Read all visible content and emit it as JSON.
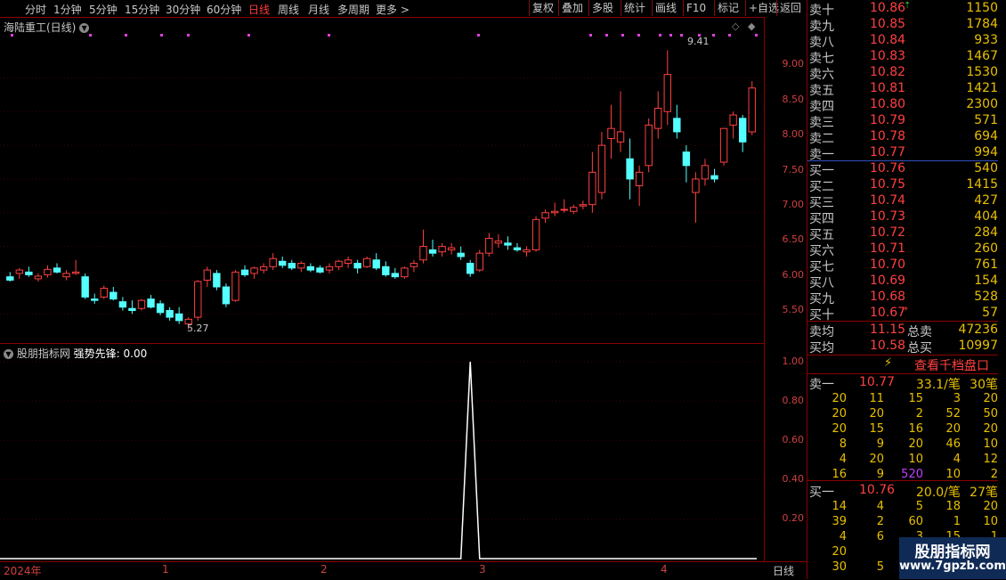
{
  "toolbar": {
    "periods": [
      "分时",
      "1分钟",
      "5分钟",
      "15分钟",
      "30分钟",
      "60分钟",
      "日线",
      "周线",
      "月线",
      "多周期",
      "更多 >"
    ],
    "active_period": "日线",
    "right_buttons": [
      "复权",
      "叠加",
      "多股",
      "统计",
      "画线",
      "F10",
      "标记",
      "+自选",
      "返回"
    ]
  },
  "main_chart": {
    "title": "海陆重工(日线)",
    "high_marker": "9.41",
    "low_marker": "5.27",
    "y_ticks": [
      "9.00",
      "8.50",
      "8.00",
      "7.50",
      "7.00",
      "6.50",
      "6.00",
      "5.50"
    ]
  },
  "indicator": {
    "title": "股朋指标网",
    "name_label": "强势先锋: 0.00",
    "y_ticks": [
      "1.00",
      "0.80",
      "0.60",
      "0.40",
      "0.20"
    ]
  },
  "date_axis": {
    "labels": [
      "2024年",
      "1",
      "2",
      "3",
      "4"
    ],
    "period_label": "日线"
  },
  "chart_data": {
    "type": "candlestick",
    "title": "海陆重工(日线)",
    "ylim": [
      5.2,
      9.6
    ],
    "candles": [
      [
        6.05,
        6.12,
        5.98,
        6.0
      ],
      [
        6.1,
        6.18,
        6.02,
        6.15
      ],
      [
        6.12,
        6.2,
        6.05,
        6.08
      ],
      [
        6.02,
        6.1,
        5.98,
        6.06
      ],
      [
        6.08,
        6.22,
        6.04,
        6.16
      ],
      [
        6.18,
        6.25,
        6.1,
        6.12
      ],
      [
        6.05,
        6.15,
        6.0,
        6.1
      ],
      [
        6.1,
        6.3,
        6.08,
        6.12
      ],
      [
        6.05,
        6.1,
        5.72,
        5.75
      ],
      [
        5.72,
        5.8,
        5.65,
        5.7
      ],
      [
        5.75,
        5.92,
        5.72,
        5.88
      ],
      [
        5.82,
        5.9,
        5.7,
        5.72
      ],
      [
        5.68,
        5.75,
        5.55,
        5.6
      ],
      [
        5.58,
        5.7,
        5.5,
        5.55
      ],
      [
        5.58,
        5.72,
        5.55,
        5.7
      ],
      [
        5.72,
        5.78,
        5.58,
        5.6
      ],
      [
        5.65,
        5.7,
        5.48,
        5.52
      ],
      [
        5.55,
        5.6,
        5.4,
        5.45
      ],
      [
        5.5,
        5.6,
        5.35,
        5.4
      ],
      [
        5.35,
        5.45,
        5.27,
        5.42
      ],
      [
        5.45,
        6.0,
        5.4,
        5.98
      ],
      [
        6.0,
        6.2,
        5.9,
        6.15
      ],
      [
        6.1,
        6.15,
        5.85,
        5.9
      ],
      [
        5.9,
        5.95,
        5.6,
        5.65
      ],
      [
        5.7,
        6.15,
        5.68,
        6.12
      ],
      [
        6.15,
        6.22,
        6.05,
        6.08
      ],
      [
        6.1,
        6.2,
        6.02,
        6.18
      ],
      [
        6.15,
        6.25,
        6.1,
        6.2
      ],
      [
        6.2,
        6.4,
        6.15,
        6.32
      ],
      [
        6.28,
        6.35,
        6.18,
        6.22
      ],
      [
        6.25,
        6.3,
        6.15,
        6.18
      ],
      [
        6.18,
        6.28,
        6.12,
        6.25
      ],
      [
        6.2,
        6.25,
        6.12,
        6.15
      ],
      [
        6.18,
        6.22,
        6.1,
        6.12
      ],
      [
        6.15,
        6.25,
        6.1,
        6.2
      ],
      [
        6.2,
        6.3,
        6.15,
        6.28
      ],
      [
        6.25,
        6.35,
        6.18,
        6.3
      ],
      [
        6.25,
        6.3,
        6.1,
        6.18
      ],
      [
        6.2,
        6.35,
        6.18,
        6.32
      ],
      [
        6.3,
        6.4,
        6.15,
        6.18
      ],
      [
        6.2,
        6.28,
        6.05,
        6.08
      ],
      [
        6.1,
        6.18,
        6.02,
        6.05
      ],
      [
        6.05,
        6.2,
        6.02,
        6.18
      ],
      [
        6.2,
        6.3,
        6.12,
        6.25
      ],
      [
        6.3,
        6.75,
        6.25,
        6.5
      ],
      [
        6.45,
        6.6,
        6.35,
        6.4
      ],
      [
        6.42,
        6.55,
        6.35,
        6.5
      ],
      [
        6.45,
        6.55,
        6.38,
        6.48
      ],
      [
        6.4,
        6.5,
        6.3,
        6.35
      ],
      [
        6.25,
        6.3,
        6.05,
        6.1
      ],
      [
        6.15,
        6.45,
        6.12,
        6.4
      ],
      [
        6.4,
        6.7,
        6.35,
        6.62
      ],
      [
        6.55,
        6.68,
        6.48,
        6.58
      ],
      [
        6.55,
        6.65,
        6.45,
        6.52
      ],
      [
        6.48,
        6.55,
        6.42,
        6.45
      ],
      [
        6.42,
        6.5,
        6.35,
        6.45
      ],
      [
        6.45,
        6.95,
        6.42,
        6.9
      ],
      [
        6.92,
        7.05,
        6.85,
        7.0
      ],
      [
        7.0,
        7.15,
        6.95,
        7.02
      ],
      [
        7.05,
        7.2,
        7.0,
        7.05
      ],
      [
        7.02,
        7.12,
        6.98,
        7.08
      ],
      [
        7.1,
        7.18,
        7.05,
        7.12
      ],
      [
        7.12,
        7.9,
        7.0,
        7.6
      ],
      [
        7.3,
        8.2,
        7.2,
        8.0
      ],
      [
        8.1,
        8.6,
        7.8,
        8.25
      ],
      [
        8.05,
        8.8,
        7.9,
        8.2
      ],
      [
        7.8,
        8.1,
        7.2,
        7.5
      ],
      [
        7.4,
        7.7,
        7.1,
        7.6
      ],
      [
        7.7,
        8.4,
        7.6,
        8.3
      ],
      [
        8.25,
        8.8,
        8.1,
        8.55
      ],
      [
        8.5,
        9.41,
        8.3,
        9.05
      ],
      [
        8.4,
        8.6,
        8.1,
        8.2
      ],
      [
        7.9,
        8.0,
        7.45,
        7.7
      ],
      [
        7.3,
        7.6,
        6.85,
        7.5
      ],
      [
        7.5,
        7.8,
        7.4,
        7.7
      ],
      [
        7.55,
        7.65,
        7.45,
        7.5
      ],
      [
        7.75,
        8.2,
        7.7,
        8.25
      ],
      [
        8.3,
        8.5,
        8.1,
        8.45
      ],
      [
        8.4,
        8.45,
        7.9,
        8.05
      ],
      [
        8.2,
        8.95,
        8.15,
        8.85
      ]
    ],
    "indicator_series": {
      "name": "强势先锋",
      "ylim": [
        0,
        1.0
      ],
      "spike_index": 49,
      "values_note": "0 everywhere except 1.00 at spike_index"
    }
  },
  "order_book": {
    "asks": [
      {
        "label": "卖十",
        "price": "10.86",
        "vol": "1150"
      },
      {
        "label": "卖九",
        "price": "10.85",
        "vol": "1784"
      },
      {
        "label": "卖八",
        "price": "10.84",
        "vol": "933"
      },
      {
        "label": "卖七",
        "price": "10.83",
        "vol": "1467"
      },
      {
        "label": "卖六",
        "price": "10.82",
        "vol": "1530"
      },
      {
        "label": "卖五",
        "price": "10.81",
        "vol": "1421"
      },
      {
        "label": "卖四",
        "price": "10.80",
        "vol": "2300"
      },
      {
        "label": "卖三",
        "price": "10.79",
        "vol": "571"
      },
      {
        "label": "卖二",
        "price": "10.78",
        "vol": "694"
      },
      {
        "label": "卖一",
        "price": "10.77",
        "vol": "994"
      }
    ],
    "bids": [
      {
        "label": "买一",
        "price": "10.76",
        "vol": "540"
      },
      {
        "label": "买二",
        "price": "10.75",
        "vol": "1415"
      },
      {
        "label": "买三",
        "price": "10.74",
        "vol": "427"
      },
      {
        "label": "买四",
        "price": "10.73",
        "vol": "404"
      },
      {
        "label": "买五",
        "price": "10.72",
        "vol": "284"
      },
      {
        "label": "买六",
        "price": "10.71",
        "vol": "260"
      },
      {
        "label": "买七",
        "price": "10.70",
        "vol": "761"
      },
      {
        "label": "买八",
        "price": "10.69",
        "vol": "154"
      },
      {
        "label": "买九",
        "price": "10.68",
        "vol": "528"
      },
      {
        "label": "买十",
        "price": "10.67",
        "vol": "57"
      }
    ],
    "summary": [
      {
        "label": "卖均",
        "price": "11.15",
        "label2": "总卖",
        "vol": "47236"
      },
      {
        "label": "买均",
        "price": "10.58",
        "label2": "总买",
        "vol": "10997"
      }
    ],
    "thousand_link": "查看千档盘口",
    "sell1_detail": {
      "label": "卖一",
      "price": "10.77",
      "per": "33.1/笔",
      "count": "30笔"
    },
    "sell1_ticks": [
      [
        "20",
        "11",
        "15",
        "3",
        "20"
      ],
      [
        "20",
        "20",
        "2",
        "52",
        "50"
      ],
      [
        "20",
        "15",
        "16",
        "20",
        "20"
      ],
      [
        "8",
        "9",
        "20",
        "46",
        "10"
      ],
      [
        "4",
        "20",
        "10",
        "4",
        "12"
      ],
      [
        "16",
        "9",
        "520",
        "10",
        "2"
      ]
    ],
    "sell1_ticks_last": "10",
    "buy1_detail": {
      "label": "买一",
      "price": "10.76",
      "per": "20.0/笔",
      "count": "27笔"
    },
    "buy1_ticks": [
      [
        "14",
        "4",
        "5",
        "18",
        "20"
      ],
      [
        "39",
        "2",
        "60",
        "1",
        "10"
      ],
      [
        "4",
        "6",
        "3",
        "15",
        "1"
      ],
      [
        "20"
      ],
      [
        "30",
        "5"
      ]
    ]
  },
  "watermark": {
    "line1": "股朋指标网",
    "line2": "www.7gpzb.com"
  }
}
